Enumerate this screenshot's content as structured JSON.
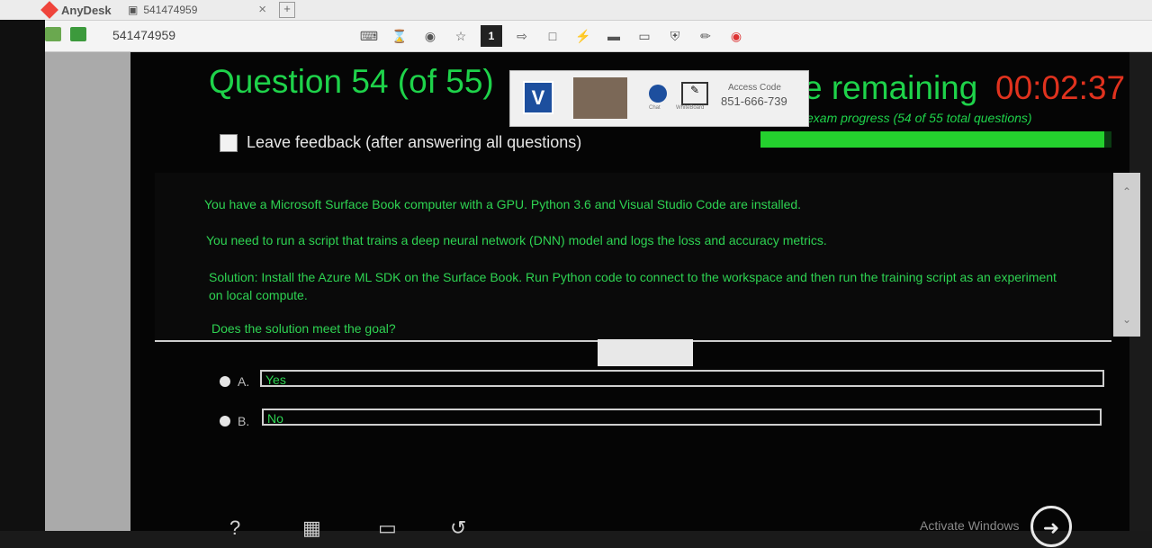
{
  "anydesk": {
    "brand": "AnyDesk",
    "tab_title": "541474959",
    "address": "541474959",
    "toolbar_badge": "1",
    "overlay": {
      "logo_letter": "V",
      "chat_label": "Chat",
      "whiteboard_label": "WhiteBoard",
      "access_code_label": "Access Code",
      "access_code": "851-666-739"
    }
  },
  "exam": {
    "question_title": "Question 54 (of 55)",
    "time_label": "e remaining",
    "time_value": "00:02:37",
    "progress_text": "exam progress (54 of 55 total questions)",
    "progress_fraction": 0.98,
    "feedback_label": "Leave feedback (after answering all questions)",
    "question_lines": [
      "You have a Microsoft Surface Book computer with a GPU. Python 3.6 and Visual Studio Code are installed.",
      "You need to run a script that trains a deep neural network (DNN) model and logs the loss and accuracy metrics.",
      "Solution: Install the Azure ML SDK on the Surface Book. Run Python code to connect to the workspace and then run the training script as an experiment on local compute.",
      "Does the solution meet the goal?"
    ],
    "options": [
      {
        "letter": "A.",
        "text": "Yes"
      },
      {
        "letter": "B.",
        "text": "No"
      }
    ],
    "activate_text": "Activate Windows"
  },
  "colors": {
    "exam_green": "#1ed34a",
    "timer_red": "#e0321e",
    "progress_fill": "#24d12e",
    "anydesk_red": "#ef443b"
  },
  "icons": [
    "help-icon",
    "calculator-icon",
    "review-screen-icon",
    "previous-icon",
    "next-arrow-icon"
  ]
}
